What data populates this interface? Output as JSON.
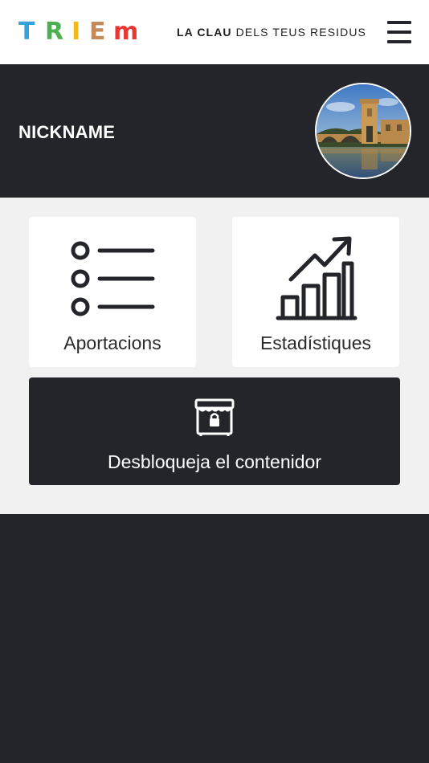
{
  "header": {
    "logo": {
      "letters": [
        {
          "char": "T",
          "color": "#35a3d9"
        },
        {
          "char": "R",
          "color": "#4caf50"
        },
        {
          "char": "I",
          "color": "#f2b81c"
        },
        {
          "char": "E",
          "color": "#c48a5a"
        },
        {
          "char": "m",
          "color": "#e53935"
        }
      ]
    },
    "tagline_bold": "LA CLAU",
    "tagline_rest": " DELS TEUS RESIDUS",
    "menu_icon": "hamburger-menu-icon"
  },
  "profile": {
    "nickname": "NICKNAME",
    "avatar_icon": "town-bridge-photo"
  },
  "actions": {
    "contributions": {
      "label": "Aportacions",
      "icon": "list-icon"
    },
    "statistics": {
      "label": "Estadístiques",
      "icon": "bar-chart-growth-icon"
    },
    "unlock": {
      "label": "Desbloqueja el contenidor",
      "icon": "locked-container-icon"
    }
  },
  "colors": {
    "dark": "#23252a",
    "panel": "#f1f1f1",
    "card": "#ffffff"
  }
}
